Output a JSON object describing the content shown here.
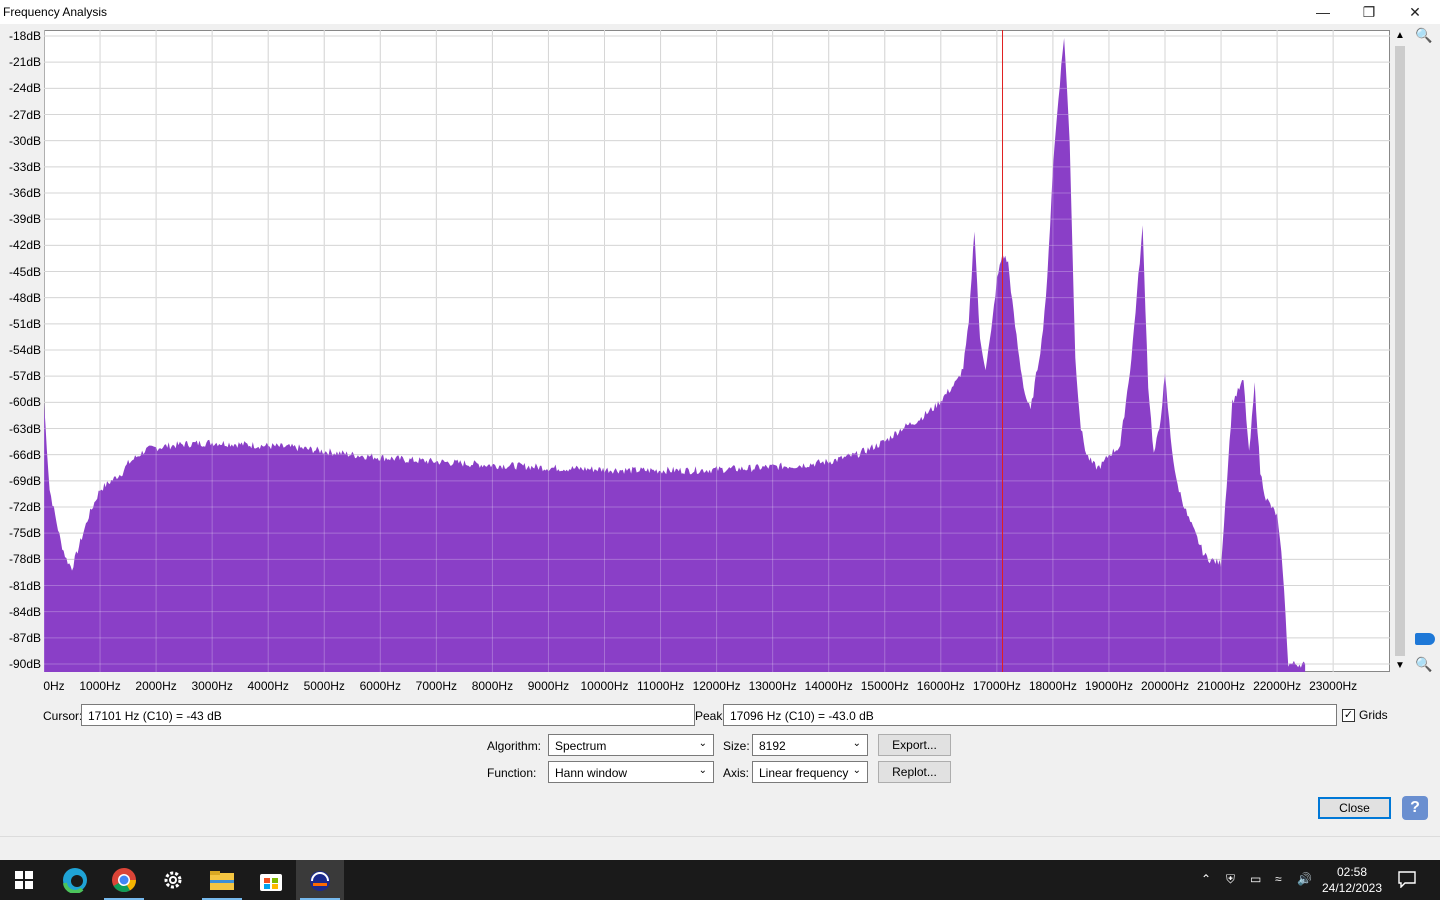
{
  "window": {
    "title": "Frequency Analysis"
  },
  "chart_data": {
    "type": "area",
    "ylim": [
      -90,
      -18
    ],
    "xlim": [
      0,
      24000
    ],
    "y_ticks": [
      "-18dB",
      "-21dB",
      "-24dB",
      "-27dB",
      "-30dB",
      "-33dB",
      "-36dB",
      "-39dB",
      "-42dB",
      "-45dB",
      "-48dB",
      "-51dB",
      "-54dB",
      "-57dB",
      "-60dB",
      "-63dB",
      "-66dB",
      "-69dB",
      "-72dB",
      "-75dB",
      "-78dB",
      "-81dB",
      "-84dB",
      "-87dB",
      "-90dB"
    ],
    "y_tick_values": [
      -18,
      -21,
      -24,
      -27,
      -30,
      -33,
      -36,
      -39,
      -42,
      -45,
      -48,
      -51,
      -54,
      -57,
      -60,
      -63,
      -66,
      -69,
      -72,
      -75,
      -78,
      -81,
      -84,
      -87,
      -90
    ],
    "x_ticks": [
      "0Hz",
      "1000Hz",
      "2000Hz",
      "3000Hz",
      "4000Hz",
      "5000Hz",
      "6000Hz",
      "7000Hz",
      "8000Hz",
      "9000Hz",
      "10000Hz",
      "11000Hz",
      "12000Hz",
      "13000Hz",
      "14000Hz",
      "15000Hz",
      "16000Hz",
      "17000Hz",
      "18000Hz",
      "19000Hz",
      "20000Hz",
      "21000Hz",
      "22000Hz",
      "23000Hz"
    ],
    "x_tick_values": [
      0,
      1000,
      2000,
      3000,
      4000,
      5000,
      6000,
      7000,
      8000,
      9000,
      10000,
      11000,
      12000,
      13000,
      14000,
      15000,
      16000,
      17000,
      18000,
      19000,
      20000,
      21000,
      22000,
      23000
    ],
    "grid": true,
    "cursor_hz": 17101,
    "series": [
      {
        "color": "#8a3fc7",
        "x": [
          0,
          100,
          200,
          300,
          400,
          500,
          600,
          700,
          800,
          900,
          1000,
          1200,
          1400,
          1500,
          1600,
          1700,
          1800,
          2000,
          2200,
          2500,
          3000,
          3500,
          4000,
          4500,
          5000,
          5500,
          6000,
          6500,
          7000,
          7500,
          8000,
          8500,
          9000,
          9500,
          10000,
          10500,
          11000,
          11500,
          12000,
          12500,
          13000,
          13500,
          14000,
          14500,
          15000,
          15300,
          15600,
          15900,
          16100,
          16300,
          16400,
          16500,
          16600,
          16700,
          16800,
          16900,
          17000,
          17100,
          17200,
          17300,
          17400,
          17500,
          17600,
          17700,
          17800,
          17900,
          18000,
          18100,
          18200,
          18300,
          18400,
          18500,
          18600,
          18700,
          18800,
          18900,
          19000,
          19200,
          19400,
          19600,
          19700,
          19800,
          19900,
          20000,
          20100,
          20200,
          20300,
          20400,
          20500,
          20600,
          20700,
          20800,
          21000,
          21200,
          21400,
          21500,
          21600,
          21700,
          21800,
          21900,
          22000,
          22100,
          22200,
          22300,
          22400,
          22500
        ],
        "values": [
          -60,
          -70,
          -73,
          -76,
          -78,
          -79,
          -77,
          -75,
          -73,
          -71.5,
          -70,
          -69,
          -68,
          -67,
          -66.5,
          -66,
          -65.5,
          -65.2,
          -65,
          -64.8,
          -64.6,
          -64.8,
          -65,
          -65.2,
          -65.6,
          -66,
          -66.3,
          -66.6,
          -66.8,
          -67,
          -67.2,
          -67.3,
          -67.5,
          -67.6,
          -67.7,
          -67.8,
          -67.8,
          -67.8,
          -67.7,
          -67.6,
          -67.4,
          -67.2,
          -66.8,
          -66,
          -64.5,
          -63,
          -62,
          -60.5,
          -59,
          -57.5,
          -56,
          -51,
          -40,
          -53,
          -56,
          -52,
          -46,
          -43,
          -44,
          -50,
          -55,
          -59,
          -61,
          -57,
          -53,
          -46,
          -33,
          -25,
          -18,
          -30,
          -55,
          -63,
          -66,
          -67,
          -67.5,
          -67,
          -66,
          -65,
          -55,
          -40,
          -58,
          -66,
          -63,
          -57,
          -64,
          -69,
          -71,
          -73,
          -74.5,
          -76,
          -77.5,
          -78,
          -78.5,
          -60,
          -57.5,
          -66,
          -58,
          -68,
          -71,
          -72,
          -73,
          -79,
          -90,
          -90,
          -90,
          -90
        ]
      }
    ]
  },
  "cursor": {
    "label": "Cursor:",
    "value": "17101 Hz (C10) = -43 dB"
  },
  "peak": {
    "label": "Peak:",
    "value": "17096 Hz (C10) = -43.0 dB"
  },
  "grids": {
    "label": "Grids",
    "checked_mark": "✓"
  },
  "algorithm": {
    "label": "Algorithm:",
    "value": "Spectrum"
  },
  "function": {
    "label": "Function:",
    "value": "Hann window"
  },
  "size": {
    "label": "Size:",
    "value": "8192"
  },
  "axis": {
    "label": "Axis:",
    "value": "Linear frequency"
  },
  "buttons": {
    "export": "Export...",
    "replot": "Replot...",
    "close": "Close",
    "help": "?"
  },
  "taskbar": {
    "time": "02:58",
    "date": "24/12/2023"
  }
}
